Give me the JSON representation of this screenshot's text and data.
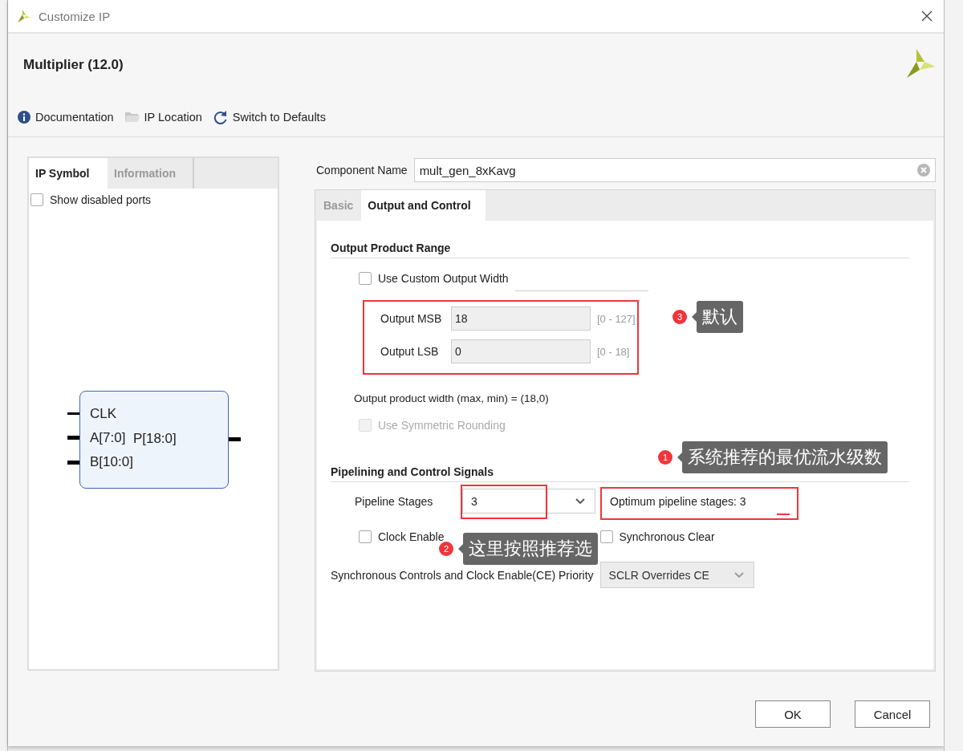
{
  "window": {
    "title": "Customize IP"
  },
  "header": {
    "title": "Multiplier (12.0)"
  },
  "toolbar": [
    {
      "label": "Documentation",
      "kind": "info"
    },
    {
      "label": "IP Location",
      "kind": "folder"
    },
    {
      "label": "Switch to Defaults",
      "kind": "refresh"
    }
  ],
  "left_panel": {
    "tabs": [
      {
        "label": "IP Symbol",
        "selected": true
      },
      {
        "label": "Information",
        "selected": false
      }
    ],
    "show_disabled_ports": {
      "label": "Show disabled ports",
      "checked": false
    },
    "symbol": {
      "inputs": [
        "CLK",
        "A[7:0]",
        "B[10:0]"
      ],
      "outputs": [
        "P[18:0]"
      ]
    }
  },
  "component_name": {
    "label": "Component Name",
    "value": "mult_gen_8xKavg"
  },
  "tabs": [
    {
      "label": "Basic",
      "selected": false
    },
    {
      "label": "Output and Control",
      "selected": true
    }
  ],
  "output_range": {
    "heading": "Output Product Range",
    "use_custom": {
      "label": "Use Custom Output Width",
      "checked": false
    },
    "fields": [
      {
        "label": "Output MSB",
        "value": "18",
        "range": "[0 - 127]",
        "disabled": true
      },
      {
        "label": "Output LSB",
        "value": "0",
        "range": "[0 - 18]",
        "disabled": true
      }
    ],
    "width_text": "Output product width (max, min) = (18,0)",
    "symmetric": {
      "label": "Use Symmetric Rounding",
      "checked": false,
      "disabled": true
    }
  },
  "pipelining": {
    "heading": "Pipelining and Control Signals",
    "stages": {
      "label": "Pipeline Stages",
      "value": "3"
    },
    "optimum": "Optimum pipeline stages: 3",
    "checks": [
      {
        "label": "Clock Enable",
        "checked": false
      },
      {
        "label": "Synchronous Clear",
        "checked": false
      }
    ],
    "priority": {
      "label": "Synchronous Controls and Clock Enable(CE) Priority",
      "value": "SCLR Overrides CE",
      "disabled": true
    }
  },
  "buttons": [
    {
      "label": "OK"
    },
    {
      "label": "Cancel"
    }
  ],
  "annotations": [
    {
      "number": "3",
      "text": "默认"
    },
    {
      "number": "1",
      "text": "系统推荐的最优流水级数"
    },
    {
      "number": "2",
      "text": "这里按照推荐选"
    }
  ]
}
